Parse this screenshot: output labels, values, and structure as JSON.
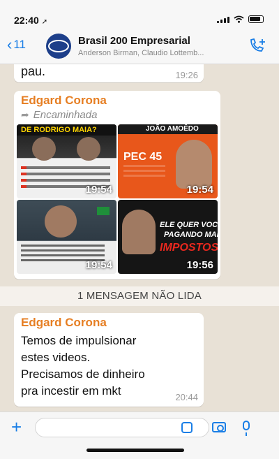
{
  "status_bar": {
    "time": "22:40",
    "location_glyph": "➚"
  },
  "header": {
    "back_count": "11",
    "title": "Brasil 200 Empresarial",
    "participants": "Anderson Birman, Claudio Lottemb..."
  },
  "messages": [
    {
      "text": "pau.",
      "time": "19:26"
    },
    {
      "sender": "Edgard Corona",
      "forwarded_label": "Encaminhada",
      "videos": [
        {
          "time": "19:54",
          "caption": "DE RODRIGO MAIA?"
        },
        {
          "time": "19:54",
          "caption": "JOÃO AMOÊDO",
          "subtitle": "PEC 45"
        },
        {
          "time": "19:54"
        },
        {
          "time": "19:56",
          "caption_lines": [
            "ELE QUER VOCÊ",
            "PAGANDO MAIS",
            "IMPOSTOS!"
          ]
        }
      ]
    }
  ],
  "unread_divider": "1 MENSAGEM NÃO LIDA",
  "last_message": {
    "sender": "Edgard Corona",
    "lines": [
      "Temos de impulsionar",
      "estes videos.",
      "Precisamos de dinheiro",
      "pra incestir em mkt"
    ],
    "time": "20:44"
  },
  "colors": {
    "accent": "#1a7ee6",
    "sender": "#e67e22",
    "chat_bg": "#e8e1d6"
  }
}
